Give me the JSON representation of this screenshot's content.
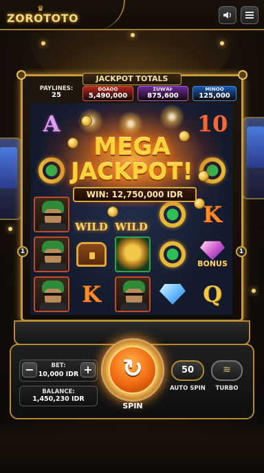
{
  "app": {
    "logo_text": "ZOROTOTO"
  },
  "header": {
    "sound_icon": "speaker-icon",
    "menu_icon": "hamburger-menu-icon"
  },
  "jackpot": {
    "title": "JACKPOT TOTALS",
    "paylines_label": "PAYLINES:",
    "paylines_value": "25",
    "boxes": [
      {
        "label": "ƉOAOO",
        "value": "5,490,000",
        "color": "#b0281e",
        "border": "#e0563a"
      },
      {
        "label": "ƩUⱲAⱵ",
        "value": "875,600",
        "color": "#6a2a9a",
        "border": "#b05ad9"
      },
      {
        "label": "MINOO",
        "value": "125,000",
        "color": "#1a5ab0",
        "border": "#3a8ae0"
      }
    ]
  },
  "win": {
    "line1": "MEGA",
    "line2": "JACKPOT!",
    "amount": "WIN: 12,750,000 IDR"
  },
  "reels": {
    "symbols": {
      "a": "A",
      "ten": "10",
      "k": "K",
      "q": "Q",
      "wild": "WILD",
      "bonus": "BONUS"
    },
    "left_marker": "1",
    "right_marker": "1"
  },
  "controls": {
    "bet_label": "BET:",
    "bet_value": "10,000 IDR",
    "minus": "−",
    "plus": "+",
    "balance_label": "BALANCE:",
    "balance_value": "1,450,230 IDR",
    "spin_label": "SPIN",
    "spin_icon": "↻",
    "auto_spin_value": "50",
    "auto_spin_label": "AUTO SPIN",
    "turbo_label": "TURBO",
    "turbo_icon": "≋"
  }
}
